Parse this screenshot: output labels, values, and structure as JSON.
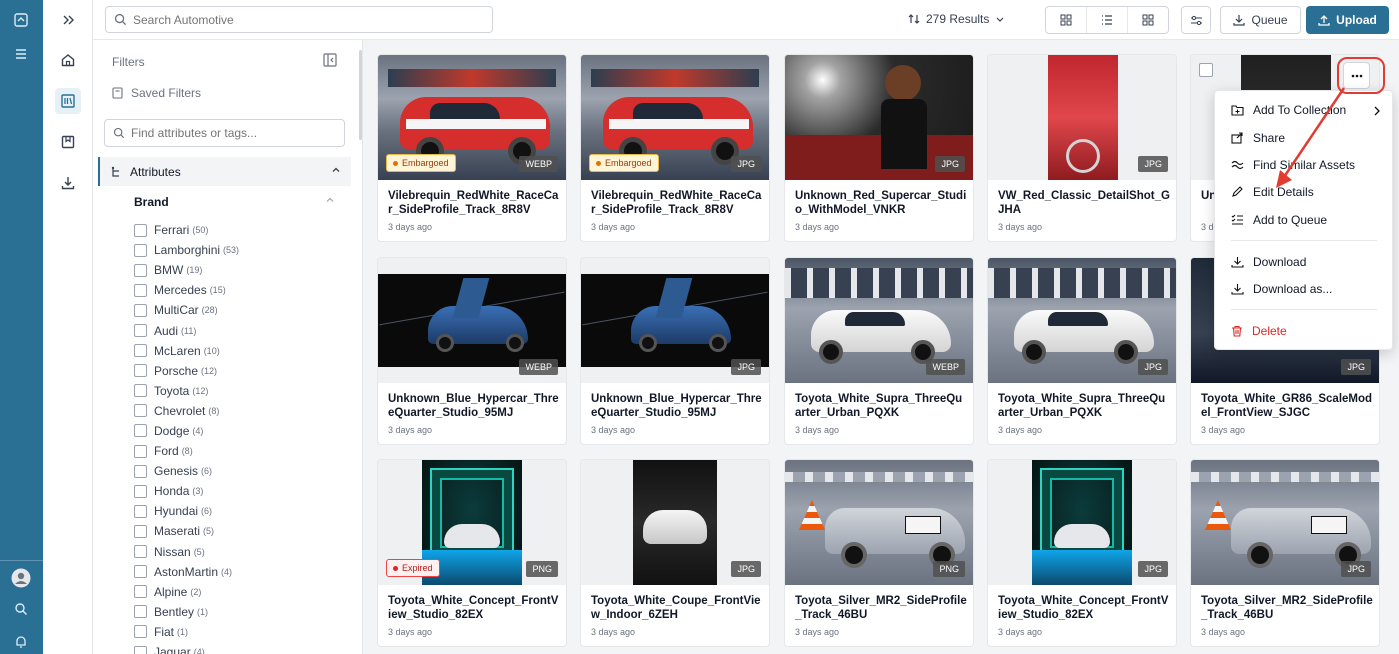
{
  "topbar": {
    "search_placeholder": "Search Automotive",
    "results_label": "279 Results",
    "queue_label": "Queue",
    "upload_label": "Upload"
  },
  "filters": {
    "title": "Filters",
    "saved_filters": "Saved Filters",
    "search_placeholder": "Find attributes or tags...",
    "attributes_label": "Attributes",
    "brand_label": "Brand",
    "brands": [
      {
        "name": "Ferrari",
        "count": "(50)"
      },
      {
        "name": "Lamborghini",
        "count": "(53)"
      },
      {
        "name": "BMW",
        "count": "(19)"
      },
      {
        "name": "Mercedes",
        "count": "(15)"
      },
      {
        "name": "MultiCar",
        "count": "(28)"
      },
      {
        "name": "Audi",
        "count": "(11)"
      },
      {
        "name": "McLaren",
        "count": "(10)"
      },
      {
        "name": "Porsche",
        "count": "(12)"
      },
      {
        "name": "Toyota",
        "count": "(12)"
      },
      {
        "name": "Chevrolet",
        "count": "(8)"
      },
      {
        "name": "Dodge",
        "count": "(4)"
      },
      {
        "name": "Ford",
        "count": "(8)"
      },
      {
        "name": "Genesis",
        "count": "(6)"
      },
      {
        "name": "Honda",
        "count": "(3)"
      },
      {
        "name": "Hyundai",
        "count": "(6)"
      },
      {
        "name": "Maserati",
        "count": "(5)"
      },
      {
        "name": "Nissan",
        "count": "(5)"
      },
      {
        "name": "AstonMartin",
        "count": "(4)"
      },
      {
        "name": "Alpine",
        "count": "(2)"
      },
      {
        "name": "Bentley",
        "count": "(1)"
      },
      {
        "name": "Fiat",
        "count": "(1)"
      },
      {
        "name": "Jaguar",
        "count": "(4)"
      }
    ]
  },
  "assets": [
    {
      "name": "Vilebrequin_RedWhite_RaceCar_SideProfile_Track_8R8V",
      "date": "3 days ago",
      "format": "WEBP",
      "status": "Embargoed",
      "img": "redcar"
    },
    {
      "name": "Vilebrequin_RedWhite_RaceCar_SideProfile_Track_8R8V",
      "date": "3 days ago",
      "format": "JPG",
      "status": "Embargoed",
      "img": "redcar"
    },
    {
      "name": "Unknown_Red_Supercar_Studio_WithModel_VNKR",
      "date": "3 days ago",
      "format": "JPG",
      "status": "",
      "img": "model"
    },
    {
      "name": "VW_Red_Classic_DetailShot_GJHA",
      "date": "3 days ago",
      "format": "JPG",
      "status": "",
      "img": "vwred"
    },
    {
      "name": "Unknown_Dark_Detail",
      "date": "3 days ago",
      "format": "",
      "status": "",
      "img": "dark"
    },
    {
      "name": "Unknown_Blue_Hypercar_ThreeQuarter_Studio_95MJ",
      "date": "3 days ago",
      "format": "WEBP",
      "status": "",
      "img": "blue"
    },
    {
      "name": "Unknown_Blue_Hypercar_ThreeQuarter_Studio_95MJ",
      "date": "3 days ago",
      "format": "JPG",
      "status": "",
      "img": "blue"
    },
    {
      "name": "Toyota_White_Supra_ThreeQuarter_Urban_PQXK",
      "date": "3 days ago",
      "format": "WEBP",
      "status": "",
      "img": "supra"
    },
    {
      "name": "Toyota_White_Supra_ThreeQuarter_Urban_PQXK",
      "date": "3 days ago",
      "format": "JPG",
      "status": "",
      "img": "supra"
    },
    {
      "name": "Toyota_White_GR86_ScaleModel_FrontView_SJGC",
      "date": "3 days ago",
      "format": "JPG",
      "status": "",
      "img": "gr86"
    },
    {
      "name": "Toyota_White_Concept_FrontView_Studio_82EX",
      "date": "3 days ago",
      "format": "PNG",
      "status": "Expired",
      "img": "concept"
    },
    {
      "name": "Toyota_White_Coupe_FrontView_Indoor_6ZEH",
      "date": "3 days ago",
      "format": "JPG",
      "status": "",
      "img": "coupe"
    },
    {
      "name": "Toyota_Silver_MR2_SideProfile_Track_46BU",
      "date": "3 days ago",
      "format": "PNG",
      "status": "",
      "img": "mr2"
    },
    {
      "name": "Toyota_White_Concept_FrontView_Studio_82EX",
      "date": "3 days ago",
      "format": "JPG",
      "status": "",
      "img": "concept"
    },
    {
      "name": "Toyota_Silver_MR2_SideProfile_Track_46BU",
      "date": "3 days ago",
      "format": "JPG",
      "status": "",
      "img": "mr2"
    }
  ],
  "context_menu": {
    "items": [
      {
        "label": "Add To Collection",
        "icon": "folder-plus-icon"
      },
      {
        "label": "Share",
        "icon": "share-icon"
      },
      {
        "label": "Find Similar Assets",
        "icon": "similar-icon"
      },
      {
        "label": "Edit Details",
        "icon": "pencil-icon"
      },
      {
        "label": "Add to Queue",
        "icon": "queue-add-icon"
      },
      {
        "label": "Download",
        "icon": "download-icon"
      },
      {
        "label": "Download as...",
        "icon": "download-icon"
      },
      {
        "label": "Delete",
        "icon": "trash-icon"
      }
    ]
  },
  "colors": {
    "brand": "#2a6f94",
    "danger": "#dc2626",
    "annotation": "#e03c31"
  }
}
